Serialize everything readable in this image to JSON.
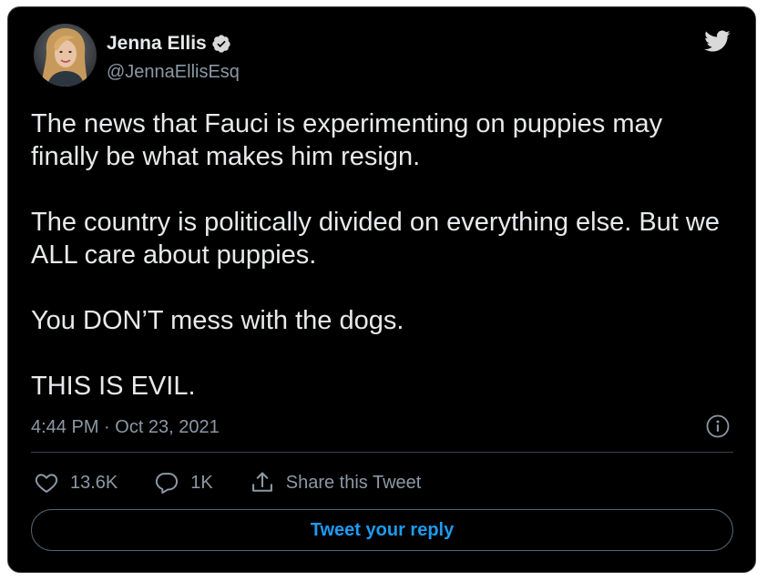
{
  "author": {
    "display_name": "Jenna Ellis",
    "handle": "@JennaEllisEsq",
    "verified": true
  },
  "tweet": {
    "paragraphs": [
      "The news that Fauci is experimenting on puppies may finally be what makes him resign.",
      "The country is politically divided on everything else. But we ALL care about puppies.",
      "You DON’T mess with the dogs.",
      "THIS IS EVIL."
    ],
    "timestamp": "4:44 PM · Oct 23, 2021"
  },
  "actions": {
    "like_count": "13.6K",
    "reply_count": "1K",
    "share_label": "Share this Tweet"
  },
  "reply_button_label": "Tweet your reply",
  "icons": {
    "logo": "twitter-bird-icon",
    "verified": "verified-badge-icon",
    "info": "info-icon",
    "like": "heart-icon",
    "reply": "comment-icon",
    "share": "share-icon"
  },
  "colors": {
    "background": "#000000",
    "text": "#e7e9ea",
    "muted": "#8b98a5",
    "accent": "#1d9bf0",
    "border": "#3d4247"
  }
}
